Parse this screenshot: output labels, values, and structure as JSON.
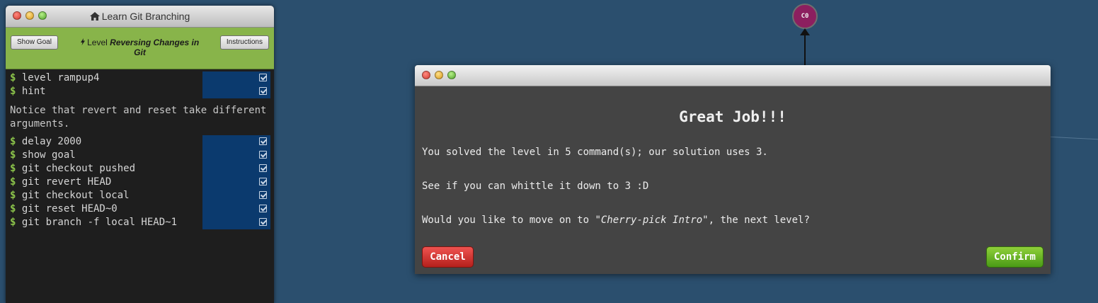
{
  "terminal": {
    "title": "Learn Git Branching",
    "show_goal_label": "Show Goal",
    "instructions_label": "Instructions",
    "level_prefix": "Level",
    "level_name": "Reversing Changes in Git",
    "prompt_symbol": "$",
    "commands_a": [
      "level rampup4",
      "hint"
    ],
    "hint_text": "Notice that revert and reset take different arguments.",
    "commands_b": [
      "delay 2000",
      "show goal",
      "git checkout pushed",
      "git revert HEAD",
      "git checkout local",
      "git reset HEAD~0",
      "git branch -f local HEAD~1"
    ]
  },
  "graph": {
    "commit_label": "C0",
    "commit_color": "#8c1f5f"
  },
  "modal": {
    "heading": "Great Job!!!",
    "line1": "You solved the level in 5 command(s); our solution uses 3.",
    "line2": "See if you can whittle it down to 3 :D",
    "line3_before": "Would you like to move on to ",
    "line3_level": "\"Cherry-pick Intro\"",
    "line3_after": ", the next level?",
    "cancel_label": "Cancel",
    "confirm_label": "Confirm"
  },
  "colors": {
    "background": "#2b4f6e",
    "goal_bar": "#88b44a",
    "prompt": "#8bc34a",
    "cancel": "#c62828",
    "confirm": "#5bab1f"
  }
}
